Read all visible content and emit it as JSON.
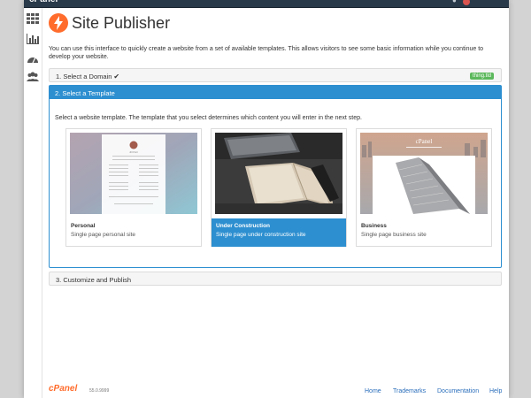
{
  "topbar": {
    "logo": "cPanel",
    "user_label": "…",
    "logout_label": "…"
  },
  "sidebar": {
    "items": [
      {
        "icon": "grid-icon"
      },
      {
        "icon": "stats-icon"
      },
      {
        "icon": "dashboard-icon"
      },
      {
        "icon": "users-icon"
      }
    ]
  },
  "header": {
    "title": "Site Publisher",
    "icon": "bolt-icon"
  },
  "intro": "You can use this interface to quickly create a website from a set of available templates. This allows visitors to see some basic information while you continue to develop your website.",
  "steps": {
    "one": {
      "label": "1. Select a Domain",
      "check": "✔",
      "domain": "thing.tld"
    },
    "two": {
      "label": "2. Select a Template"
    },
    "three": {
      "label": "3. Customize and Publish"
    }
  },
  "template_instruction": "Select a website template. The template that you select determines which content you will enter in the next step.",
  "templates": [
    {
      "name": "Personal",
      "desc": "Single page personal site",
      "selected": false
    },
    {
      "name": "Under Construction",
      "desc": "Single page under construction site",
      "selected": true
    },
    {
      "name": "Business",
      "desc": "Single page business site",
      "selected": false
    }
  ],
  "thumb_text": {
    "personal_name": "Jill Parr",
    "business_logo": "cPanel"
  },
  "footer": {
    "logo": "cPanel",
    "version": "55.0.9999",
    "links": [
      "Home",
      "Trademarks",
      "Documentation",
      "Help"
    ]
  }
}
